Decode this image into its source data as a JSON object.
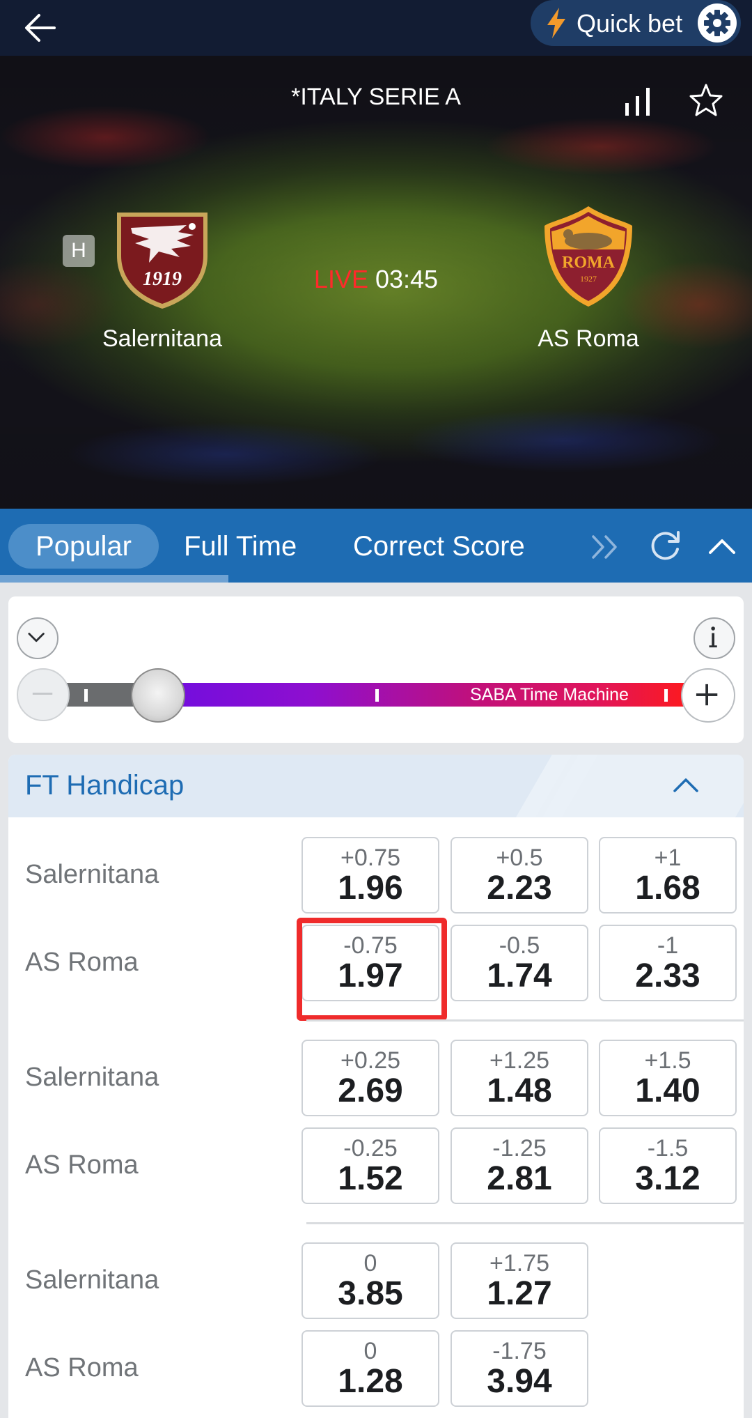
{
  "topbar": {
    "back_icon": "back-arrow-icon",
    "quick_bet_label": "Quick bet",
    "bolt_icon": "lightning-bolt-icon",
    "settings_icon": "gear-icon"
  },
  "match": {
    "league": "*ITALY SERIE A",
    "home_badge": "H",
    "home_team": "Salernitana",
    "away_team": "AS Roma",
    "live_tag": "LIVE",
    "clock": "03:45",
    "home_crest_text": "1919",
    "away_crest_text": "ROMA",
    "away_crest_year": "1927"
  },
  "tabs": [
    {
      "label": "Popular",
      "active": true
    },
    {
      "label": "Full Time",
      "active": false
    },
    {
      "label": "Correct Score",
      "active": false
    }
  ],
  "time_machine": {
    "label": "SABA Time Machine",
    "info_glyph": "i"
  },
  "market": {
    "title": "FT Handicap",
    "groups": [
      {
        "home": {
          "name": "Salernitana",
          "odds": [
            {
              "line": "+0.75",
              "price": "1.96"
            },
            {
              "line": "+0.5",
              "price": "2.23"
            },
            {
              "line": "+1",
              "price": "1.68"
            }
          ]
        },
        "away": {
          "name": "AS Roma",
          "odds": [
            {
              "line": "-0.75",
              "price": "1.97"
            },
            {
              "line": "-0.5",
              "price": "1.74"
            },
            {
              "line": "-1",
              "price": "2.33"
            }
          ]
        }
      },
      {
        "home": {
          "name": "Salernitana",
          "odds": [
            {
              "line": "+0.25",
              "price": "2.69"
            },
            {
              "line": "+1.25",
              "price": "1.48"
            },
            {
              "line": "+1.5",
              "price": "1.40"
            }
          ]
        },
        "away": {
          "name": "AS Roma",
          "odds": [
            {
              "line": "-0.25",
              "price": "1.52"
            },
            {
              "line": "-1.25",
              "price": "2.81"
            },
            {
              "line": "-1.5",
              "price": "3.12"
            }
          ]
        }
      },
      {
        "home": {
          "name": "Salernitana",
          "odds": [
            {
              "line": "0",
              "price": "3.85"
            },
            {
              "line": "+1.75",
              "price": "1.27"
            }
          ]
        },
        "away": {
          "name": "AS Roma",
          "odds": [
            {
              "line": "0",
              "price": "1.28"
            },
            {
              "line": "-1.75",
              "price": "3.94"
            }
          ]
        }
      }
    ],
    "highlight_color": "#ef2b2b"
  },
  "colors": {
    "topbar": "#121c33",
    "tab_bar": "#1e6cb3",
    "live": "#ff2a2a",
    "accent": "#1e6cb3"
  }
}
